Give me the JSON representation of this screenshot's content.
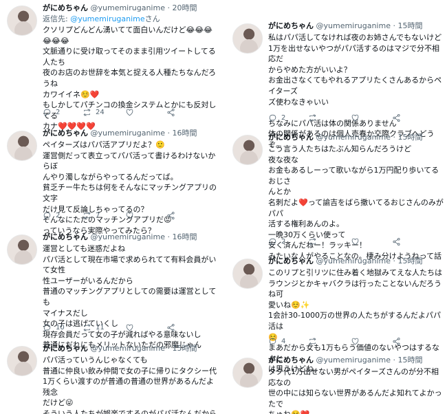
{
  "left": [
    {
      "name": "がにめちゃん",
      "handle": "@yumemiruganime",
      "time": "20時間",
      "reply_prefix": "返信先: ",
      "reply_mention": "@yumemiruganime",
      "reply_suffix": "さん",
      "text": "クソリプどんどん湧いてて面白いんだけど😂😂😂😂😂😂\n文脈通りに受け取ってそのまま引用ツイートしてる人たち\n夜のお店のお世辞を本気と捉える人種たちなんだろうね\nカワイイネ☺️❤️\nもしかしてパチンコの換金システムとかにも反対してる\nカナ❤️❤️❤️❤️",
      "replies": "2",
      "retweets": "24",
      "likes": ""
    },
    {
      "name": "がにめちゃん",
      "handle": "@yumemiruganime",
      "time": "16時間",
      "text": "ペイターズはパパ活アプリだよ？🙂\n運営側だって表立ってパパ活って書けるわけないからぼ\nんやり濁しながらやってるんだってば。\n貧乏チー牛たちは何をそんなにマッチングアプリの文字\nだけ見て反論しちゃってるの？\nそんなにただのマッチングアプリだ😡\nっていうなら実際やってみたら？",
      "replies": "2",
      "retweets": "7",
      "likes": ""
    },
    {
      "name": "がにめちゃん",
      "handle": "@yumemiruganime",
      "time": "16時間",
      "text": "運営としても迷惑だよね\nパパ活として現在市場で求められてて有料会員がいて女性\n性ユーザーがいるんだから\n普通のマッチングアプリとしての需要は運営としても\nマイナスだし\n女の子は逃げていくし\n現存会員だって女の子が減ればやる意味ないし\n普通にだれにもメリットないただの邪魔じゃん",
      "replies": "10",
      "retweets": "11",
      "likes": ""
    },
    {
      "name": "がにめちゃん",
      "handle": "@yumemiruganime",
      "time": "15時間",
      "text": "パパ活っていうんじゃなくても\n普通に仲良い飲み仲間で女の子に帰りにタクシー代\n1万くらい渡すのが普通の普通の世界があるんだよ残念\nだけど😜\nそういう人たちが娯楽でするのがパパ活なんだから\n貧乏人たちほんとおもしろいな😜",
      "replies": "",
      "retweets": "",
      "likes": ""
    }
  ],
  "right": [
    {
      "name": "がにめちゃん",
      "handle": "@yumemiruganime",
      "time": "15時間",
      "text": "私はパパ活してなければ夜のお姉さんでもないけど\n1万を出せないやつがパパ活するのはマジで分不相応だ\nからやめた方がいいよ？\nお金出さなくてもやれるアプリたくさんあるからペイターズ\nズ使わなきゃいい\n\nちなみにパパ活は体の関係ありません\n体の関係があるのは個人売春か交際クラブへどうぞ。",
      "replies": "2",
      "retweets": "",
      "likes": ""
    },
    {
      "name": "がにめちゃん",
      "handle": "@yumemiruganime",
      "time": "15時間",
      "text": "こう言う人たちはたぶん知らんだろうけど\n夜な夜な\nお金もあるしーって歌いながら1万円配り歩いてるおじさ\nんとか\n名刺だよ❤️って諭吉をばら撒いてるおじさんのみがパパ\n活する権利あんのよ。\n一晩30万くらい使って\n安く済んだねー！ラッキー！\nみたいな人がやることなの。棲み分けようねって話",
      "replies": "2",
      "retweets": "",
      "likes": ""
    },
    {
      "name": "がにめちゃん",
      "handle": "@yumemiruganime",
      "time": "15時間",
      "text": "このリプと引リツに住み着く地獄みてえな人たちは\nラウンジとかキャバクラは行ったことないんだろうね可\n愛いね☺️✨\n1会計30-1000万の世界の人たちがするんだよパパ活は\n☺️\nまあだから女も1万もらう価値のないやつはするなよと\nは思うけどね。",
      "replies": "4",
      "retweets": "",
      "likes": ""
    },
    {
      "name": "がにめちゃん",
      "handle": "@yumemiruganime",
      "time": "15時間",
      "text": "タク代1万出せない男がペイターズさんのが分不相応なの\n世の中には知らない世界があるんだよ知れてよかったで\nちゅね☺️❤️",
      "replies": "",
      "retweets": "",
      "likes": ""
    }
  ]
}
